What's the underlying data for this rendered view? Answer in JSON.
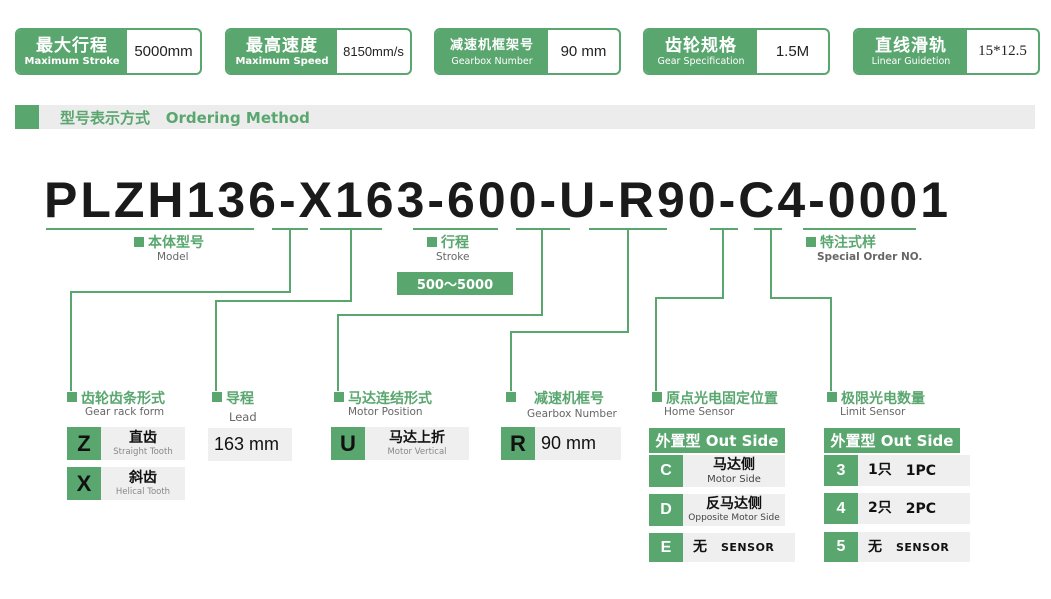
{
  "specs": [
    {
      "cn": "最大行程",
      "en": "Maximum Stroke",
      "value": "5000mm"
    },
    {
      "cn": "最高速度",
      "en": "Maximum Speed",
      "value": "8150mm/s"
    },
    {
      "cn": "减速机框架号",
      "en": "Gearbox Number",
      "value": "90 mm"
    },
    {
      "cn": "齿轮规格",
      "en": "Gear Specification",
      "value": "1.5M"
    },
    {
      "cn": "直线滑轨",
      "en": "Linear Guidetion",
      "value": "15*12.5"
    }
  ],
  "section": {
    "title_cn": "型号表示方式",
    "title_en": "Ordering Method"
  },
  "code": {
    "text": "PLZH136-X163-600-U-R90-C4-0001"
  },
  "labels": {
    "model": {
      "cn": "本体型号",
      "en": "Model"
    },
    "stroke": {
      "cn": "行程",
      "en": "Stroke",
      "range": "500～5000"
    },
    "special": {
      "cn": "特注式样",
      "en": "Special Order NO."
    },
    "gear_rack": {
      "cn": "齿轮齿条形式",
      "en": "Gear rack form"
    },
    "lead": {
      "cn": "导程",
      "en": "Lead",
      "value": "163 mm"
    },
    "motor_pos": {
      "cn": "马达连结形式",
      "en": "Motor Position"
    },
    "gearbox": {
      "cn": "减速机框号",
      "en": "Gearbox Number"
    },
    "home": {
      "cn": "原点光电固定位置",
      "en": "Home Sensor"
    },
    "limit": {
      "cn": "极限光电数量",
      "en": "Limit Sensor"
    }
  },
  "gear_rack_opts": [
    {
      "code": "Z",
      "cn": "直齿",
      "en": "Straight Tooth"
    },
    {
      "code": "X",
      "cn": "斜齿",
      "en": "Helical Tooth"
    }
  ],
  "motor_opt": {
    "code": "U",
    "cn": "马达上折",
    "en": "Motor Vertical"
  },
  "gearbox_opt": {
    "code": "R",
    "value": "90 mm"
  },
  "home_header": "外置型 Out Side",
  "home_opts": [
    {
      "code": "C",
      "cn": "马达侧",
      "en": "Motor Side"
    },
    {
      "code": "D",
      "cn": "反马达侧",
      "en": "Opposite Motor Side"
    },
    {
      "code": "E",
      "cn": "无",
      "en": "SENSOR"
    }
  ],
  "limit_header": "外置型 Out Side",
  "limit_opts": [
    {
      "code": "3",
      "cn": "1只",
      "pc": "1PC"
    },
    {
      "code": "4",
      "cn": "2只",
      "pc": "2PC"
    },
    {
      "code": "5",
      "cn": "无",
      "pc": "SENSOR"
    }
  ],
  "colors": {
    "accent": "#5aa66f",
    "grey": "#efefef"
  }
}
